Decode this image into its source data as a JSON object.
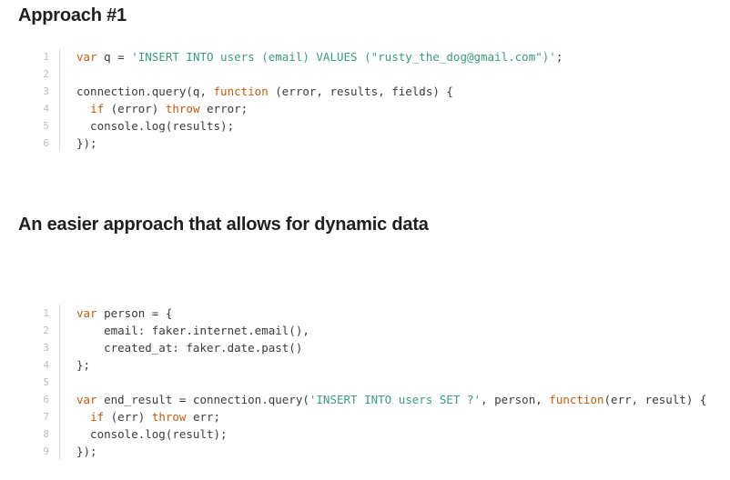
{
  "colors": {
    "heading": "#1f1f1f",
    "code_text": "#3b3b3b",
    "keyword": "#c25c14",
    "string": "#3c9c7a",
    "line_number": "#bdbdbd",
    "gutter_border": "#dcdcdc"
  },
  "sections": [
    {
      "heading": "Approach #1",
      "code_lines": [
        {
          "number": "1",
          "tokens": [
            {
              "t": "kw",
              "v": "var"
            },
            {
              "t": "plain",
              "v": " q = "
            },
            {
              "t": "str",
              "v": "'INSERT INTO users (email) VALUES (\"rusty_the_dog@gmail.com\")'"
            },
            {
              "t": "plain",
              "v": ";"
            }
          ]
        },
        {
          "number": "2",
          "tokens": []
        },
        {
          "number": "3",
          "tokens": [
            {
              "t": "plain",
              "v": "connection.query(q, "
            },
            {
              "t": "kw",
              "v": "function"
            },
            {
              "t": "plain",
              "v": " (error, results, fields) {"
            }
          ]
        },
        {
          "number": "4",
          "tokens": [
            {
              "t": "plain",
              "v": "  "
            },
            {
              "t": "kw",
              "v": "if"
            },
            {
              "t": "plain",
              "v": " (error) "
            },
            {
              "t": "kw",
              "v": "throw"
            },
            {
              "t": "plain",
              "v": " error;"
            }
          ]
        },
        {
          "number": "5",
          "tokens": [
            {
              "t": "plain",
              "v": "  console.log(results);"
            }
          ]
        },
        {
          "number": "6",
          "tokens": [
            {
              "t": "plain",
              "v": "});"
            }
          ]
        }
      ]
    },
    {
      "heading": "An easier approach that allows for dynamic data",
      "code_lines": [
        {
          "number": "1",
          "tokens": [
            {
              "t": "kw",
              "v": "var"
            },
            {
              "t": "plain",
              "v": " person = {"
            }
          ]
        },
        {
          "number": "2",
          "tokens": [
            {
              "t": "plain",
              "v": "    email: faker.internet.email(),"
            }
          ]
        },
        {
          "number": "3",
          "tokens": [
            {
              "t": "plain",
              "v": "    created_at: faker.date.past()"
            }
          ]
        },
        {
          "number": "4",
          "tokens": [
            {
              "t": "plain",
              "v": "};"
            }
          ]
        },
        {
          "number": "5",
          "tokens": []
        },
        {
          "number": "6",
          "tokens": [
            {
              "t": "kw",
              "v": "var"
            },
            {
              "t": "plain",
              "v": " end_result = connection.query("
            },
            {
              "t": "str",
              "v": "'INSERT INTO users SET ?'"
            },
            {
              "t": "plain",
              "v": ", person, "
            },
            {
              "t": "kw",
              "v": "function"
            },
            {
              "t": "plain",
              "v": "(err, result) {"
            }
          ]
        },
        {
          "number": "7",
          "tokens": [
            {
              "t": "plain",
              "v": "  "
            },
            {
              "t": "kw",
              "v": "if"
            },
            {
              "t": "plain",
              "v": " (err) "
            },
            {
              "t": "kw",
              "v": "throw"
            },
            {
              "t": "plain",
              "v": " err;"
            }
          ]
        },
        {
          "number": "8",
          "tokens": [
            {
              "t": "plain",
              "v": "  console.log(result);"
            }
          ]
        },
        {
          "number": "9",
          "tokens": [
            {
              "t": "plain",
              "v": "});"
            }
          ]
        }
      ]
    }
  ]
}
